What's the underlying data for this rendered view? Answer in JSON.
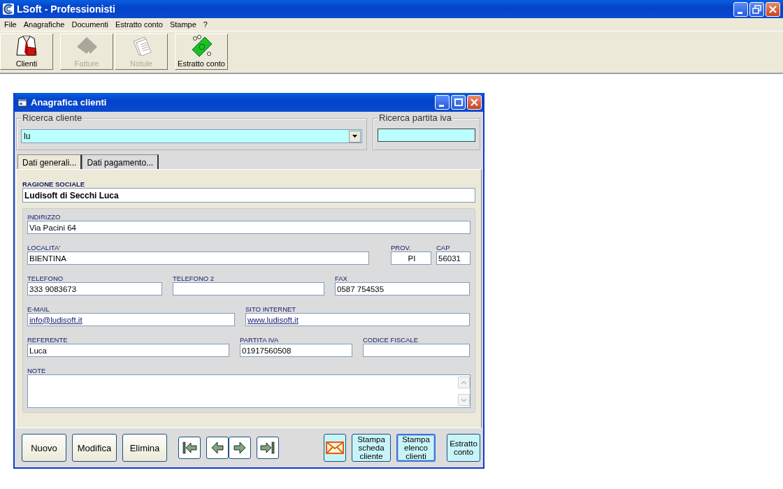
{
  "app": {
    "title": "LSoft - Professionisti",
    "menu": [
      "File",
      "Anagrafiche",
      "Documenti",
      "Estratto conto",
      "Stampe",
      "?"
    ],
    "toolbar": [
      {
        "label": "Clienti",
        "kind": "clients",
        "disabled": false
      },
      {
        "label": "Fatture",
        "kind": "invoices",
        "disabled": true
      },
      {
        "label": "Notule",
        "kind": "notes",
        "disabled": true
      },
      {
        "label": "Estratto conto",
        "kind": "statement",
        "disabled": false
      }
    ]
  },
  "dialog": {
    "title": "Anagrafica clienti",
    "search_client": {
      "legend": "Ricerca cliente",
      "value": "lu"
    },
    "search_vat": {
      "legend": "Ricerca partita iva"
    },
    "tabs": [
      {
        "label": "Dati generali...",
        "selected": true
      },
      {
        "label": "Dati pagamento...",
        "selected": false
      }
    ],
    "company": {
      "label": "RAGIONE SOCIALE",
      "value": "Ludisoft di Secchi Luca"
    },
    "field_rows": [
      [
        {
          "label": "INDIRIZZO",
          "value": "Via Pacini 64",
          "kind": "text"
        }
      ],
      [
        {
          "label": "LOCALITA'",
          "value": "BIENTINA",
          "kind": "text"
        },
        {
          "label": "PROV.",
          "value": "PI",
          "kind": "text"
        },
        {
          "label": "CAP",
          "value": "56031",
          "kind": "text"
        }
      ],
      [
        {
          "label": "TELEFONO",
          "value": "333 9083673",
          "kind": "text"
        },
        {
          "label": "TELEFONO 2",
          "kind": "text"
        },
        {
          "label": "FAX",
          "value": "0587 754535",
          "kind": "text"
        }
      ],
      [
        {
          "label": "E-MAIL",
          "value": "info@ludisoft.it",
          "kind": "link"
        },
        {
          "label": "SITO INTERNET",
          "value": "www.ludisoft.it",
          "kind": "link"
        }
      ],
      [
        {
          "label": "REFERENTE",
          "value": "Luca",
          "kind": "text"
        },
        {
          "label": "PARTITA IVA",
          "value": "01917560508",
          "kind": "text"
        },
        {
          "label": "CODICE FISCALE",
          "kind": "text"
        }
      ]
    ],
    "note": {
      "label": "NOTE"
    },
    "buttons": [
      "Nuovo",
      "Modifica",
      "Elimina"
    ],
    "nav_buttons": [
      {
        "kind": "first"
      },
      {
        "kind": "prev"
      },
      {
        "kind": "next"
      },
      {
        "kind": "last"
      }
    ],
    "actions": [
      {
        "kind": "mail",
        "focused": false
      },
      {
        "kind": "print",
        "label": "Stampa scheda cliente",
        "focused": false
      },
      {
        "kind": "print",
        "label": "Stampa elenco clienti",
        "focused": true
      },
      {
        "kind": "print",
        "label": "Estratto conto",
        "focused": false
      }
    ]
  }
}
